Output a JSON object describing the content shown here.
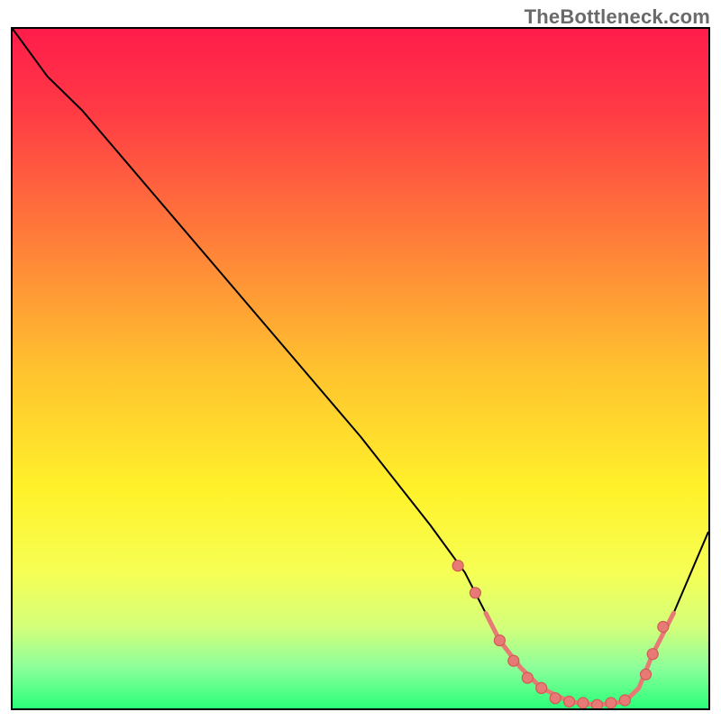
{
  "watermark": "TheBottleneck.com",
  "colors": {
    "gradient_stops": [
      {
        "offset": 0.0,
        "color": "#ff1c4b"
      },
      {
        "offset": 0.12,
        "color": "#ff3a45"
      },
      {
        "offset": 0.3,
        "color": "#ff7a3a"
      },
      {
        "offset": 0.5,
        "color": "#ffc22f"
      },
      {
        "offset": 0.68,
        "color": "#fff22a"
      },
      {
        "offset": 0.8,
        "color": "#f6ff55"
      },
      {
        "offset": 0.88,
        "color": "#d4ff7a"
      },
      {
        "offset": 0.94,
        "color": "#8cff9a"
      },
      {
        "offset": 1.0,
        "color": "#2bff7a"
      }
    ],
    "curve": "#000000",
    "dot_fill": "#e77a74",
    "dot_stroke": "#d05b55",
    "border": "#000000"
  },
  "chart_data": {
    "type": "line",
    "title": "",
    "xlabel": "",
    "ylabel": "",
    "xlim": [
      0,
      100
    ],
    "ylim": [
      0,
      100
    ],
    "grid": false,
    "legend": false,
    "series": [
      {
        "name": "bottleneck-curve",
        "x": [
          0,
          5,
          10,
          20,
          30,
          40,
          50,
          60,
          65,
          68,
          70,
          73,
          76,
          80,
          84,
          88,
          90,
          92,
          95,
          100
        ],
        "y": [
          100,
          93,
          88,
          76,
          64,
          52,
          40,
          27,
          20,
          14,
          10,
          6,
          3,
          1,
          0.5,
          1,
          3,
          8,
          14,
          26
        ]
      }
    ],
    "markers": {
      "name": "dots",
      "x": [
        64,
        66.5,
        70,
        72,
        74,
        76,
        78,
        80,
        82,
        84,
        86,
        88,
        91,
        92,
        93.5
      ],
      "y": [
        21,
        17,
        10,
        7,
        4.5,
        3,
        1.5,
        1,
        0.8,
        0.5,
        0.8,
        1.2,
        5,
        8,
        12
      ]
    }
  }
}
